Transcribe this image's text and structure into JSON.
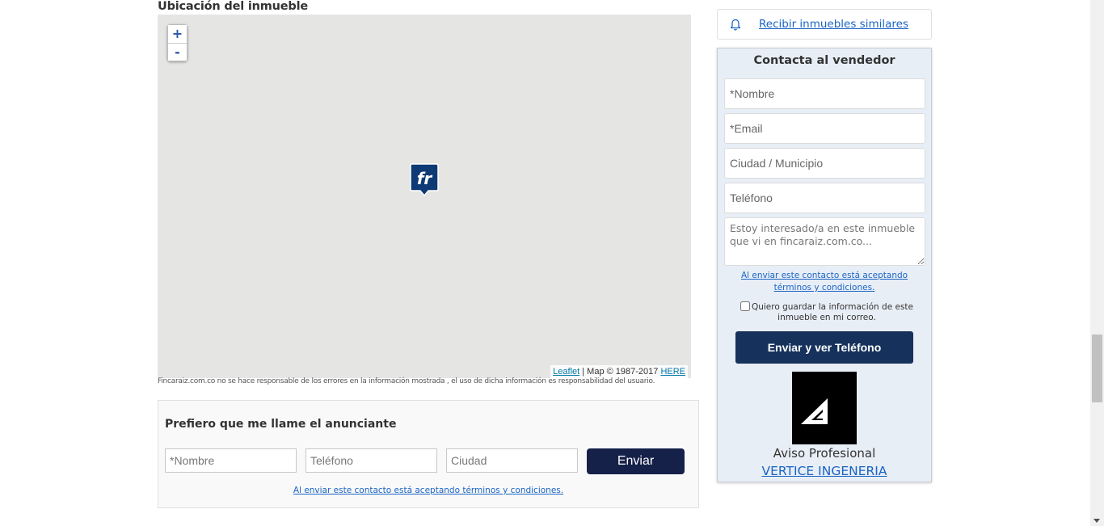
{
  "map_section": {
    "title": "Ubicación del inmueble",
    "zoom_in": "+",
    "zoom_out": "-",
    "attribution_link": "Leaflet",
    "attribution_text": " | Map © 1987-2017 ",
    "attribution_here": "HERE",
    "disclaimer": "Fincaraiz.com.co no se hace responsable de los errores en la información mostrada , el uso de dicha información es responsabilidad del usuario."
  },
  "callback_form": {
    "title": "Prefiero que me llame el anunciante",
    "name_placeholder": "*Nombre",
    "phone_placeholder": "Teléfono",
    "city_placeholder": "Ciudad",
    "submit_label": "Enviar",
    "terms": "Al enviar este contacto está aceptando términos y condiciones."
  },
  "alert": {
    "link": "Recibir inmuebles similares"
  },
  "contact_form": {
    "title": "Contacta al vendedor",
    "name_placeholder": "*Nombre",
    "email_placeholder": "*Email",
    "city_placeholder": "Ciudad / Municipio",
    "phone_placeholder": "Teléfono",
    "message_placeholder": "Estoy interesado/a en este inmueble que vi en fincaraiz.com.co...",
    "terms": "Al enviar este contacto está aceptando términos y condiciones.",
    "save_label": "Quiero guardar la información de este inmueble en mi correo.",
    "submit_label": "Enviar y ver Teléfono",
    "aviso_label": "Aviso Profesional",
    "company_name": "VERTICE INGENERIA"
  },
  "colors": {
    "primary_navy": "#16325c",
    "button_dark": "#16214a",
    "link_blue": "#1a64c4",
    "map_background": "#e5e5e3",
    "panel_background": "#e8eef6"
  }
}
